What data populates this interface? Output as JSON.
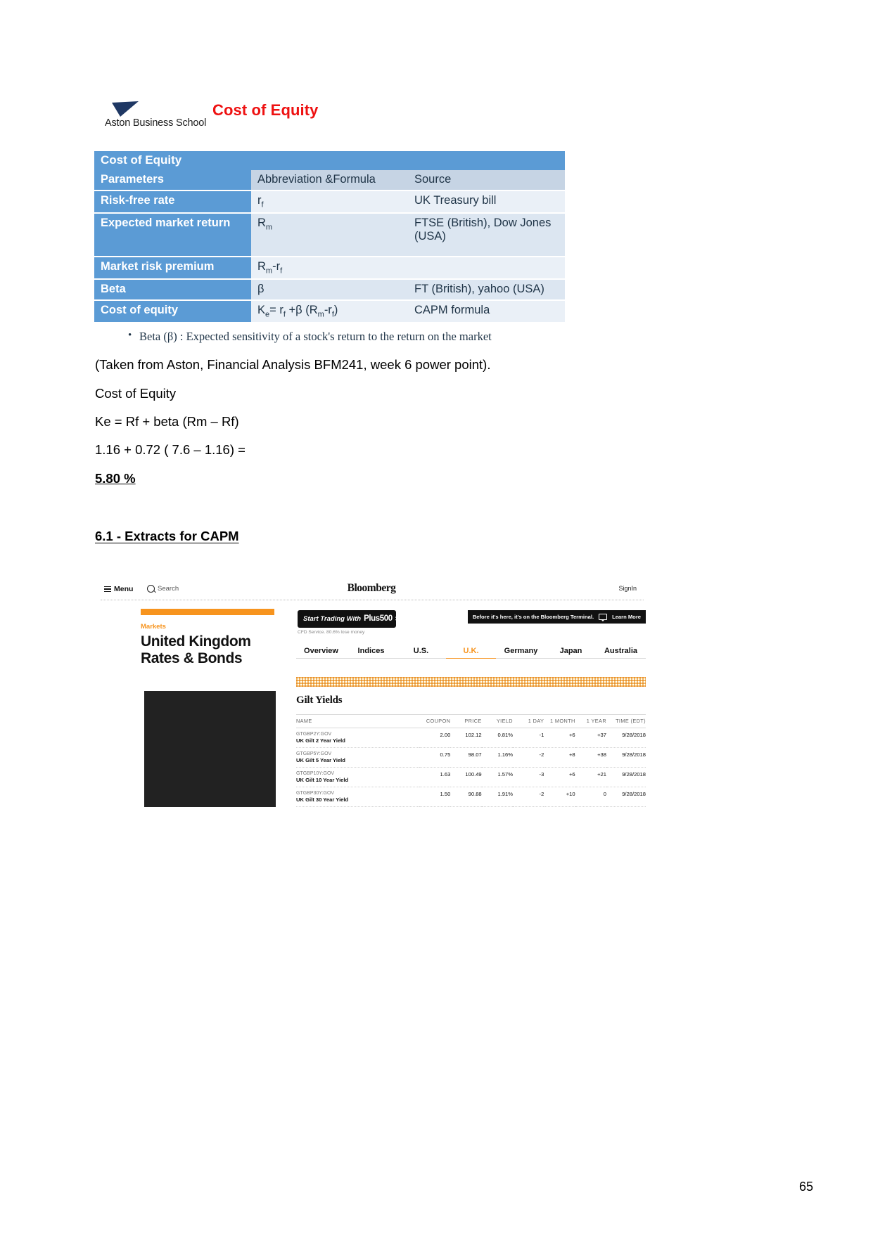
{
  "slide": {
    "brand": "Aston Business School",
    "title": "Cost of Equity",
    "table": {
      "banner": "Cost of Equity",
      "headers": [
        "Parameters",
        "Abbreviation  &Formula",
        "Source"
      ],
      "rows": [
        {
          "parameter": "Risk-free rate",
          "abbrev_html": "r<sub>f</sub>",
          "source": "UK Treasury bill"
        },
        {
          "parameter": "Expected market return",
          "abbrev_html": "R<sub>m</sub>",
          "source": "FTSE (British), Dow Jones (USA)"
        },
        {
          "parameter": "Market risk premium",
          "abbrev_html": "R<sub>m</sub>-r<sub>f</sub>",
          "source": ""
        },
        {
          "parameter": "Beta",
          "abbrev_html": "β",
          "source": "FT (British), yahoo (USA)"
        },
        {
          "parameter": "Cost of equity",
          "abbrev_html": "K<sub>e</sub>= r<sub>f</sub> +β (R<sub>m</sub>-r<sub>f</sub>)",
          "source": "CAPM formula"
        }
      ]
    },
    "bullet": "Beta (β) : Expected sensitivity of a stock's return to the return on the market"
  },
  "body": {
    "source_note": "(Taken from Aston, Financial Analysis BFM241, week 6 power point).",
    "label": "Cost of Equity",
    "formula": "Ke = Rf + beta (Rm – Rf)",
    "calculation": "1.16 + 0.72 ( 7.6 – 1.16) =",
    "result": "5.80 %",
    "section_heading": "6.1 - Extracts for CAPM"
  },
  "bloomberg": {
    "nav": {
      "menu": "Menu",
      "search": "Search",
      "logo": "Bloomberg",
      "signin": "SignIn"
    },
    "left": {
      "kicker": "Markets",
      "title_line1": "United Kingdom",
      "title_line2": "Rates & Bonds"
    },
    "ad": {
      "text": "Start Trading With",
      "brand": "Plus500",
      "arrows": ">>",
      "disclaimer": "CFD Service. 80.6% lose money"
    },
    "promo": {
      "text": "Before it's here, it's on the Bloomberg Terminal.",
      "cta": "Learn More"
    },
    "tabs": [
      {
        "label": "Overview",
        "active": false
      },
      {
        "label": "Indices",
        "active": false
      },
      {
        "label": "U.S.",
        "active": false
      },
      {
        "label": "U.K.",
        "active": true
      },
      {
        "label": "Germany",
        "active": false
      },
      {
        "label": "Japan",
        "active": false
      },
      {
        "label": "Australia",
        "active": false
      }
    ],
    "table": {
      "title": "Gilt Yields",
      "headers": [
        "NAME",
        "COUPON",
        "PRICE",
        "YIELD",
        "1 DAY",
        "1 MONTH",
        "1 YEAR",
        "TIME (EDT)"
      ],
      "rows": [
        {
          "ticker": "GTGBP2Y:GOV",
          "desc": "UK Gilt 2 Year Yield",
          "coupon": "2.00",
          "price": "102.12",
          "yield": "0.81%",
          "d1": "-1",
          "m1": "+6",
          "y1": "+37",
          "time": "9/28/2018",
          "d1_dir": "neg",
          "m1_dir": "pos",
          "y1_dir": "pos"
        },
        {
          "ticker": "GTGBP5Y:GOV",
          "desc": "UK Gilt 5 Year Yield",
          "coupon": "0.75",
          "price": "98.07",
          "yield": "1.16%",
          "d1": "-2",
          "m1": "+8",
          "y1": "+38",
          "time": "9/28/2018",
          "d1_dir": "neg",
          "m1_dir": "pos",
          "y1_dir": "pos"
        },
        {
          "ticker": "GTGBP10Y:GOV",
          "desc": "UK Gilt 10 Year Yield",
          "coupon": "1.63",
          "price": "100.49",
          "yield": "1.57%",
          "d1": "-3",
          "m1": "+6",
          "y1": "+21",
          "time": "9/28/2018",
          "d1_dir": "neg",
          "m1_dir": "pos",
          "y1_dir": "pos"
        },
        {
          "ticker": "GTGBP30Y:GOV",
          "desc": "UK Gilt 30 Year Yield",
          "coupon": "1.50",
          "price": "90.88",
          "yield": "1.91%",
          "d1": "-2",
          "m1": "+10",
          "y1": "0",
          "time": "9/28/2018",
          "d1_dir": "neg",
          "m1_dir": "pos",
          "y1_dir": "zero"
        }
      ]
    }
  },
  "page_number": "65"
}
